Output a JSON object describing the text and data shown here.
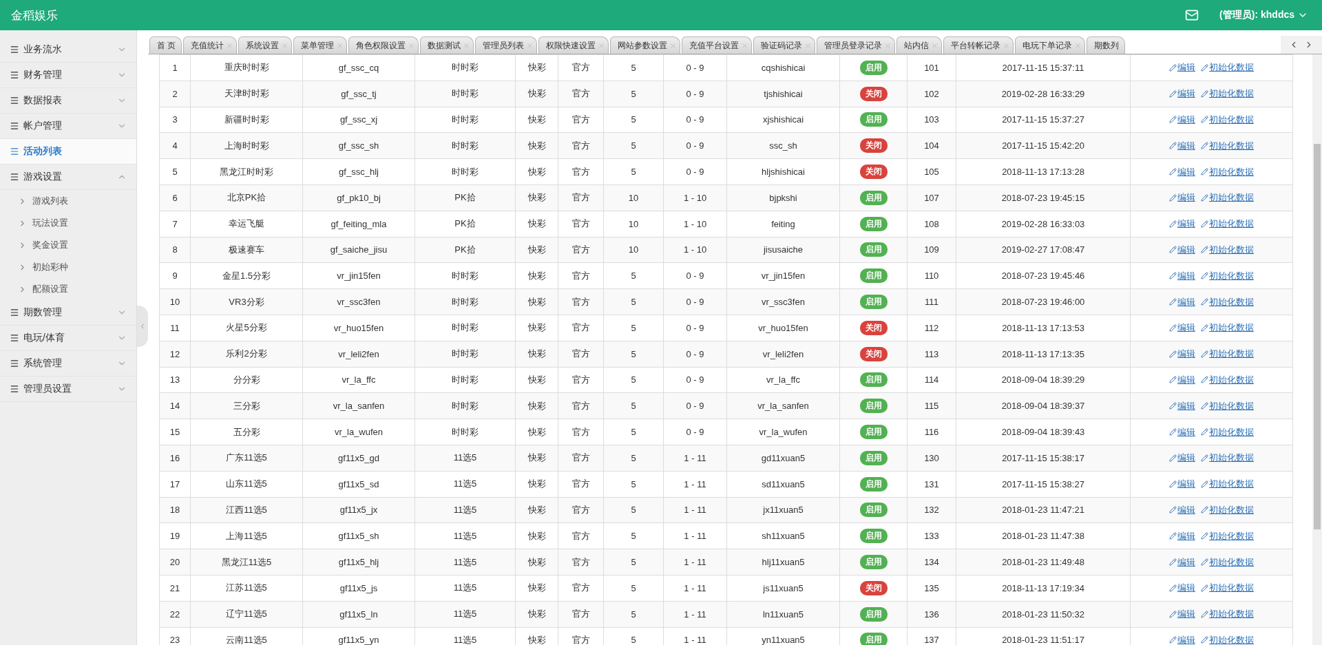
{
  "header": {
    "title": "金稻娱乐",
    "user": "(管理员): khddcs"
  },
  "sidebar": {
    "items": [
      {
        "label": "业务流水",
        "selected": false,
        "expanded": false
      },
      {
        "label": "财务管理",
        "selected": false,
        "expanded": false
      },
      {
        "label": "数据报表",
        "selected": false,
        "expanded": false
      },
      {
        "label": "帐户管理",
        "selected": false,
        "expanded": false
      },
      {
        "label": "活动列表",
        "selected": true,
        "expanded": false,
        "kind": "link"
      },
      {
        "label": "游戏设置",
        "selected": false,
        "expanded": true,
        "children": [
          {
            "label": "游戏列表"
          },
          {
            "label": "玩法设置"
          },
          {
            "label": "奖金设置"
          },
          {
            "label": "初始彩种"
          },
          {
            "label": "配额设置"
          }
        ]
      },
      {
        "label": "期数管理",
        "selected": false,
        "expanded": false
      },
      {
        "label": "电玩/体育",
        "selected": false,
        "expanded": false
      },
      {
        "label": "系统管理",
        "selected": false,
        "expanded": false
      },
      {
        "label": "管理员设置",
        "selected": false,
        "expanded": false
      }
    ]
  },
  "tabs": [
    {
      "label": "首 页",
      "closable": false
    },
    {
      "label": "充值统计",
      "closable": true
    },
    {
      "label": "系统设置",
      "closable": true
    },
    {
      "label": "菜单管理",
      "closable": true
    },
    {
      "label": "角色权限设置",
      "closable": true
    },
    {
      "label": "数据测试",
      "closable": true
    },
    {
      "label": "管理员列表",
      "closable": true
    },
    {
      "label": "权限快速设置",
      "closable": true
    },
    {
      "label": "网站参数设置",
      "closable": true
    },
    {
      "label": "充值平台设置",
      "closable": true
    },
    {
      "label": "验证码记录",
      "closable": true
    },
    {
      "label": "管理员登录记录",
      "closable": true
    },
    {
      "label": "站内信",
      "closable": true
    },
    {
      "label": "平台转帐记录",
      "closable": true
    },
    {
      "label": "电玩下单记录",
      "closable": true
    },
    {
      "label": "期数列",
      "closable": false
    }
  ],
  "table": {
    "rows": [
      {
        "no": "1",
        "name": "重庆时时彩",
        "code": "gf_ssc_cq",
        "type": "时时彩",
        "speed": "快彩",
        "source": "官方",
        "balls": "5",
        "range": "0 - 9",
        "pinyin": "cqshishicai",
        "on": true,
        "status": "启用",
        "id": "101",
        "time": "2017-11-15 15:37:11",
        "actions": [
          "编辑",
          "初始化数据"
        ]
      },
      {
        "no": "2",
        "name": "天津时时彩",
        "code": "gf_ssc_tj",
        "type": "时时彩",
        "speed": "快彩",
        "source": "官方",
        "balls": "5",
        "range": "0 - 9",
        "pinyin": "tjshishicai",
        "on": false,
        "status": "关闭",
        "id": "102",
        "time": "2019-02-28 16:33:29",
        "actions": [
          "编辑",
          "初始化数据"
        ]
      },
      {
        "no": "3",
        "name": "新疆时时彩",
        "code": "gf_ssc_xj",
        "type": "时时彩",
        "speed": "快彩",
        "source": "官方",
        "balls": "5",
        "range": "0 - 9",
        "pinyin": "xjshishicai",
        "on": true,
        "status": "启用",
        "id": "103",
        "time": "2017-11-15 15:37:27",
        "actions": [
          "编辑",
          "初始化数据"
        ]
      },
      {
        "no": "4",
        "name": "上海时时彩",
        "code": "gf_ssc_sh",
        "type": "时时彩",
        "speed": "快彩",
        "source": "官方",
        "balls": "5",
        "range": "0 - 9",
        "pinyin": "ssc_sh",
        "on": false,
        "status": "关闭",
        "id": "104",
        "time": "2017-11-15 15:42:20",
        "actions": [
          "编辑",
          "初始化数据"
        ]
      },
      {
        "no": "5",
        "name": "黑龙江时时彩",
        "code": "gf_ssc_hlj",
        "type": "时时彩",
        "speed": "快彩",
        "source": "官方",
        "balls": "5",
        "range": "0 - 9",
        "pinyin": "hljshishicai",
        "on": false,
        "status": "关闭",
        "id": "105",
        "time": "2018-11-13 17:13:28",
        "actions": [
          "编辑",
          "初始化数据"
        ]
      },
      {
        "no": "6",
        "name": "北京PK拾",
        "code": "gf_pk10_bj",
        "type": "PK拾",
        "speed": "快彩",
        "source": "官方",
        "balls": "10",
        "range": "1 - 10",
        "pinyin": "bjpkshi",
        "on": true,
        "status": "启用",
        "id": "107",
        "time": "2018-07-23 19:45:15",
        "actions": [
          "编辑",
          "初始化数据"
        ]
      },
      {
        "no": "7",
        "name": "幸运飞艇",
        "code": "gf_feiting_mla",
        "type": "PK拾",
        "speed": "快彩",
        "source": "官方",
        "balls": "10",
        "range": "1 - 10",
        "pinyin": "feiting",
        "on": true,
        "status": "启用",
        "id": "108",
        "time": "2019-02-28 16:33:03",
        "actions": [
          "编辑",
          "初始化数据"
        ]
      },
      {
        "no": "8",
        "name": "极速赛车",
        "code": "gf_saiche_jisu",
        "type": "PK拾",
        "speed": "快彩",
        "source": "官方",
        "balls": "10",
        "range": "1 - 10",
        "pinyin": "jisusaiche",
        "on": true,
        "status": "启用",
        "id": "109",
        "time": "2019-02-27 17:08:47",
        "actions": [
          "编辑",
          "初始化数据"
        ]
      },
      {
        "no": "9",
        "name": "金星1.5分彩",
        "code": "vr_jin15fen",
        "type": "时时彩",
        "speed": "快彩",
        "source": "官方",
        "balls": "5",
        "range": "0 - 9",
        "pinyin": "vr_jin15fen",
        "on": true,
        "status": "启用",
        "id": "110",
        "time": "2018-07-23 19:45:46",
        "actions": [
          "编辑",
          "初始化数据"
        ]
      },
      {
        "no": "10",
        "name": "VR3分彩",
        "code": "vr_ssc3fen",
        "type": "时时彩",
        "speed": "快彩",
        "source": "官方",
        "balls": "5",
        "range": "0 - 9",
        "pinyin": "vr_ssc3fen",
        "on": true,
        "status": "启用",
        "id": "111",
        "time": "2018-07-23 19:46:00",
        "actions": [
          "编辑",
          "初始化数据"
        ]
      },
      {
        "no": "11",
        "name": "火星5分彩",
        "code": "vr_huo15fen",
        "type": "时时彩",
        "speed": "快彩",
        "source": "官方",
        "balls": "5",
        "range": "0 - 9",
        "pinyin": "vr_huo15fen",
        "on": false,
        "status": "关闭",
        "id": "112",
        "time": "2018-11-13 17:13:53",
        "actions": [
          "编辑",
          "初始化数据"
        ]
      },
      {
        "no": "12",
        "name": "乐利2分彩",
        "code": "vr_leli2fen",
        "type": "时时彩",
        "speed": "快彩",
        "source": "官方",
        "balls": "5",
        "range": "0 - 9",
        "pinyin": "vr_leli2fen",
        "on": false,
        "status": "关闭",
        "id": "113",
        "time": "2018-11-13 17:13:35",
        "actions": [
          "编辑",
          "初始化数据"
        ]
      },
      {
        "no": "13",
        "name": "分分彩",
        "code": "vr_la_ffc",
        "type": "时时彩",
        "speed": "快彩",
        "source": "官方",
        "balls": "5",
        "range": "0 - 9",
        "pinyin": "vr_la_ffc",
        "on": true,
        "status": "启用",
        "id": "114",
        "time": "2018-09-04 18:39:29",
        "actions": [
          "编辑",
          "初始化数据"
        ]
      },
      {
        "no": "14",
        "name": "三分彩",
        "code": "vr_la_sanfen",
        "type": "时时彩",
        "speed": "快彩",
        "source": "官方",
        "balls": "5",
        "range": "0 - 9",
        "pinyin": "vr_la_sanfen",
        "on": true,
        "status": "启用",
        "id": "115",
        "time": "2018-09-04 18:39:37",
        "actions": [
          "编辑",
          "初始化数据"
        ]
      },
      {
        "no": "15",
        "name": "五分彩",
        "code": "vr_la_wufen",
        "type": "时时彩",
        "speed": "快彩",
        "source": "官方",
        "balls": "5",
        "range": "0 - 9",
        "pinyin": "vr_la_wufen",
        "on": true,
        "status": "启用",
        "id": "116",
        "time": "2018-09-04 18:39:43",
        "actions": [
          "编辑",
          "初始化数据"
        ]
      },
      {
        "no": "16",
        "name": "广东11选5",
        "code": "gf11x5_gd",
        "type": "11选5",
        "speed": "快彩",
        "source": "官方",
        "balls": "5",
        "range": "1 - 11",
        "pinyin": "gd11xuan5",
        "on": true,
        "status": "启用",
        "id": "130",
        "time": "2017-11-15 15:38:17",
        "actions": [
          "编辑",
          "初始化数据"
        ]
      },
      {
        "no": "17",
        "name": "山东11选5",
        "code": "gf11x5_sd",
        "type": "11选5",
        "speed": "快彩",
        "source": "官方",
        "balls": "5",
        "range": "1 - 11",
        "pinyin": "sd11xuan5",
        "on": true,
        "status": "启用",
        "id": "131",
        "time": "2017-11-15 15:38:27",
        "actions": [
          "编辑",
          "初始化数据"
        ]
      },
      {
        "no": "18",
        "name": "江西11选5",
        "code": "gf11x5_jx",
        "type": "11选5",
        "speed": "快彩",
        "source": "官方",
        "balls": "5",
        "range": "1 - 11",
        "pinyin": "jx11xuan5",
        "on": true,
        "status": "启用",
        "id": "132",
        "time": "2018-01-23 11:47:21",
        "actions": [
          "编辑",
          "初始化数据"
        ]
      },
      {
        "no": "19",
        "name": "上海11选5",
        "code": "gf11x5_sh",
        "type": "11选5",
        "speed": "快彩",
        "source": "官方",
        "balls": "5",
        "range": "1 - 11",
        "pinyin": "sh11xuan5",
        "on": true,
        "status": "启用",
        "id": "133",
        "time": "2018-01-23 11:47:38",
        "actions": [
          "编辑",
          "初始化数据"
        ]
      },
      {
        "no": "20",
        "name": "黑龙江11选5",
        "code": "gf11x5_hlj",
        "type": "11选5",
        "speed": "快彩",
        "source": "官方",
        "balls": "5",
        "range": "1 - 11",
        "pinyin": "hlj11xuan5",
        "on": true,
        "status": "启用",
        "id": "134",
        "time": "2018-01-23 11:49:48",
        "actions": [
          "编辑",
          "初始化数据"
        ]
      },
      {
        "no": "21",
        "name": "江苏11选5",
        "code": "gf11x5_js",
        "type": "11选5",
        "speed": "快彩",
        "source": "官方",
        "balls": "5",
        "range": "1 - 11",
        "pinyin": "js11xuan5",
        "on": false,
        "status": "关闭",
        "id": "135",
        "time": "2018-11-13 17:19:34",
        "actions": [
          "编辑",
          "初始化数据"
        ]
      },
      {
        "no": "22",
        "name": "辽宁11选5",
        "code": "gf11x5_ln",
        "type": "11选5",
        "speed": "快彩",
        "source": "官方",
        "balls": "5",
        "range": "1 - 11",
        "pinyin": "ln11xuan5",
        "on": true,
        "status": "启用",
        "id": "136",
        "time": "2018-01-23 11:50:32",
        "actions": [
          "编辑",
          "初始化数据"
        ]
      },
      {
        "no": "23",
        "name": "云南11选5",
        "code": "gf11x5_yn",
        "type": "11选5",
        "speed": "快彩",
        "source": "官方",
        "balls": "5",
        "range": "1 - 11",
        "pinyin": "yn11xuan5",
        "on": true,
        "status": "启用",
        "id": "137",
        "time": "2018-01-23 11:51:17",
        "actions": [
          "编辑",
          "初始化数据"
        ]
      }
    ]
  }
}
